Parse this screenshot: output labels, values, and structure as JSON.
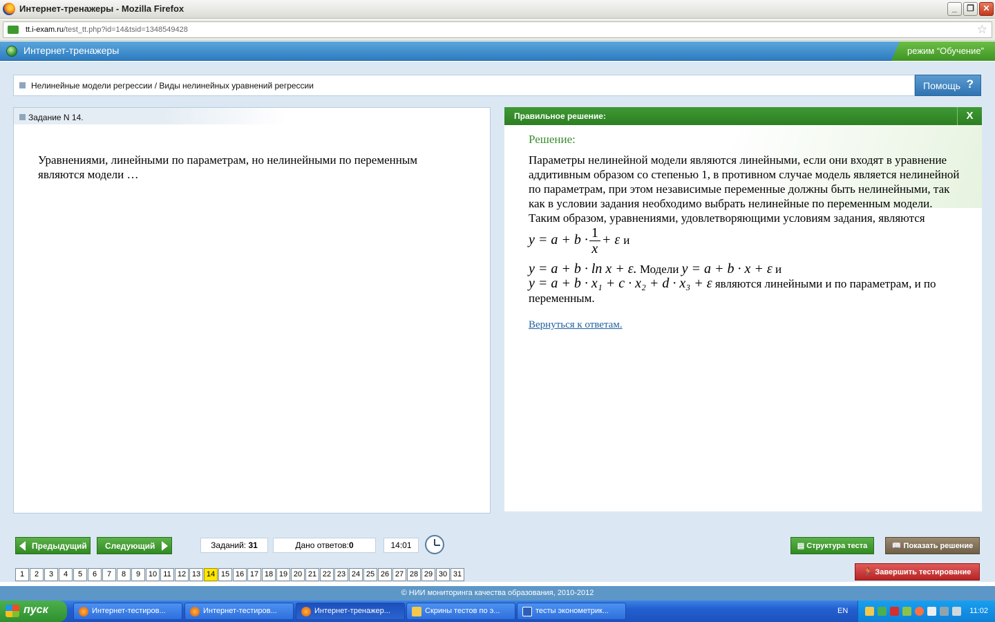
{
  "window": {
    "title": "Интернет-тренажеры - Mozilla Firefox",
    "url_host": "tt.i-exam.ru",
    "url_path": "/test_tt.php?id=14&tsid=1348549428"
  },
  "app": {
    "title": "Интернет-тренажеры",
    "mode": "режим “Обучение”"
  },
  "breadcrumb": "Нелинейные модели регрессии / Виды нелинейных уравнений регрессии",
  "help_label": "Помощь",
  "task": {
    "label": "Задание N 14.",
    "question": "Уравнениями, линейными по параметрам, но нелинейными по переменным являются модели …"
  },
  "solution": {
    "header": "Правильное решение:",
    "close": "X",
    "heading": "Решение:",
    "text_1": "Параметры нелинейной модели являются линейными, если они входят в уравнение аддитивным образом со степенью 1, в противном случае модель является нелинейной по параметрам, при этом независимые переменные должны быть нелинейными, так как в условии задания необходимо выбрать нелинейные по переменным модели. Таким образом, уравнениями, удовлетворяющими условиям задания, являются",
    "formula_1_left": "y = a + b ·",
    "formula_1_num": "1",
    "formula_1_den": "x",
    "formula_1_right": "+ ε",
    "and_1": "и",
    "formula_2": "y = a + b · ln x + ε.",
    "text_2": "Модели",
    "formula_3": "y = a + b · x + ε",
    "and_2": "и",
    "formula_4": "y = a + b · x₁ + c · x₂ + d · x₃ + ε",
    "text_3": "являются линейными и по параметрам, и по переменным.",
    "back_link": "Вернуться к ответам."
  },
  "controls": {
    "prev": "Предыдущий",
    "next": "Следующий",
    "tasks_label": "Заданий:",
    "tasks_count": "31",
    "answers_label": "Дано ответов:",
    "answers_count": "0",
    "timer": "14:01",
    "structure": "Структура теста",
    "show_solution": "Показать решение",
    "finish": "Завершить тестирование"
  },
  "pages": [
    "1",
    "2",
    "3",
    "4",
    "5",
    "6",
    "7",
    "8",
    "9",
    "10",
    "11",
    "12",
    "13",
    "14",
    "15",
    "16",
    "17",
    "18",
    "19",
    "20",
    "21",
    "22",
    "23",
    "24",
    "25",
    "26",
    "27",
    "28",
    "29",
    "30",
    "31"
  ],
  "current_page": "14",
  "footer": "© НИИ мониторинга качества образования, 2010-2012",
  "taskbar": {
    "start": "пуск",
    "tasks": [
      "Интернет-тестиров...",
      "Интернет-тестиров...",
      "Интернет-тренажер...",
      "Скрины тестов по э...",
      "тесты эконометрик..."
    ],
    "lang": "EN",
    "time": "11:02"
  },
  "colors": {
    "header_blue": "#2e7cc0",
    "mode_green": "#3e9424",
    "solution_green": "#2c7e22",
    "current_page": "#ffe800",
    "finish_red": "#b72424"
  }
}
